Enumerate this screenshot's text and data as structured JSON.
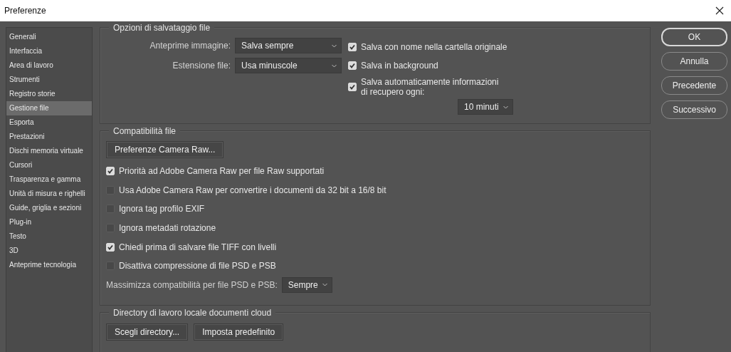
{
  "window": {
    "title": "Preferenze"
  },
  "sidebar": {
    "items": [
      {
        "label": "Generali",
        "selected": false
      },
      {
        "label": "Interfaccia",
        "selected": false
      },
      {
        "label": "Area di lavoro",
        "selected": false
      },
      {
        "label": "Strumenti",
        "selected": false
      },
      {
        "label": "Registro storie",
        "selected": false
      },
      {
        "label": "Gestione file",
        "selected": true
      },
      {
        "label": "Esporta",
        "selected": false
      },
      {
        "label": "Prestazioni",
        "selected": false
      },
      {
        "label": "Dischi memoria virtuale",
        "selected": false
      },
      {
        "label": "Cursori",
        "selected": false
      },
      {
        "label": "Trasparenza e gamma",
        "selected": false
      },
      {
        "label": "Unità di misura e righelli",
        "selected": false
      },
      {
        "label": "Guide, griglia e sezioni",
        "selected": false
      },
      {
        "label": "Plug-in",
        "selected": false
      },
      {
        "label": "Testo",
        "selected": false
      },
      {
        "label": "3D",
        "selected": false
      },
      {
        "label": "Anteprime tecnologia",
        "selected": false
      }
    ]
  },
  "save_options": {
    "title": "Opzioni di salvataggio file",
    "fields": [
      {
        "label": "Anteprime immagine:",
        "value": "Salva sempre"
      },
      {
        "label": "Estensione file:",
        "value": "Usa minuscole"
      }
    ],
    "checkboxes": [
      {
        "label": "Salva con nome nella cartella originale",
        "checked": true
      },
      {
        "label": "Salva in background",
        "checked": true
      },
      {
        "label": "Salva automaticamente informazioni di recupero ogni:",
        "checked": true
      }
    ],
    "interval": {
      "value": "10 minuti"
    }
  },
  "compatibility": {
    "title": "Compatibilità file",
    "button": "Preferenze Camera Raw...",
    "checkboxes": [
      {
        "label": "Priorità ad Adobe Camera Raw per file Raw supportati",
        "checked": true
      },
      {
        "label": "Usa Adobe Camera Raw per convertire i documenti da 32 bit a 16/8 bit",
        "checked": false
      },
      {
        "label": "Ignora tag profilo EXIF",
        "checked": false
      },
      {
        "label": "Ignora metadati rotazione",
        "checked": false
      },
      {
        "label": "Chiedi prima di salvare file TIFF con livelli",
        "checked": true
      },
      {
        "label": "Disattiva compressione di file PSD e PSB",
        "checked": false
      }
    ],
    "maximize": {
      "label": "Massimizza compatibilità per file PSD e PSB:",
      "value": "Sempre"
    }
  },
  "cloud": {
    "title": "Directory di lavoro locale documenti cloud",
    "buttons": [
      "Scegli directory...",
      "Imposta predefinito"
    ]
  },
  "dialog_buttons": [
    {
      "label": "OK",
      "default": true
    },
    {
      "label": "Annulla",
      "default": false
    },
    {
      "label": "Precedente",
      "default": false
    },
    {
      "label": "Successivo",
      "default": false
    }
  ]
}
